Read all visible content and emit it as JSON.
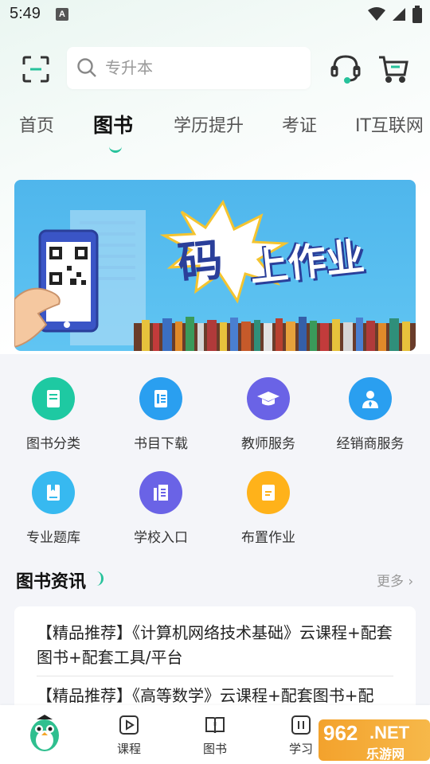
{
  "status_bar": {
    "time": "5:49",
    "notification_badge": "A"
  },
  "search": {
    "placeholder": "专升本"
  },
  "tabs": [
    {
      "label": "首页"
    },
    {
      "label": "图书",
      "active": true
    },
    {
      "label": "学历提升"
    },
    {
      "label": "考证"
    },
    {
      "label": "IT互联网"
    }
  ],
  "banner": {
    "title_char_1": "码",
    "title_rest": "上作业"
  },
  "shortcuts": [
    {
      "label": "图书分类",
      "color": "#1ec9a2",
      "icon": "book-category-icon"
    },
    {
      "label": "书目下载",
      "color": "#2a9ff0",
      "icon": "catalog-download-icon"
    },
    {
      "label": "教师服务",
      "color": "#6a63e6",
      "icon": "graduation-cap-icon"
    },
    {
      "label": "经销商服务",
      "color": "#2a9ff0",
      "icon": "dealer-person-icon"
    },
    {
      "label": "专业题库",
      "color": "#37b9f0",
      "icon": "question-bank-icon"
    },
    {
      "label": "学校入口",
      "color": "#6a63e6",
      "icon": "school-entrance-icon"
    },
    {
      "label": "布置作业",
      "color": "#ffb21a",
      "icon": "assign-homework-icon"
    }
  ],
  "news": {
    "title": "图书资讯",
    "more": "更多 ›",
    "items": [
      "【精品推荐】《计算机网络技术基础》云课程+配套图书+配套工具/平台",
      "【精品推荐】《高等数学》云课程+配套图书+配"
    ]
  },
  "bottom_nav": [
    {
      "label": "课程",
      "icon": "course-play-icon"
    },
    {
      "label": "图书",
      "icon": "book-open-icon"
    },
    {
      "label": "学习",
      "icon": "study-pause-icon"
    }
  ],
  "watermark": {
    "text_1": "962",
    "text_2": ".NET",
    "text_3": "乐游网"
  },
  "colors": {
    "accent": "#27c29b",
    "header_bg": "#eaf6f1"
  }
}
